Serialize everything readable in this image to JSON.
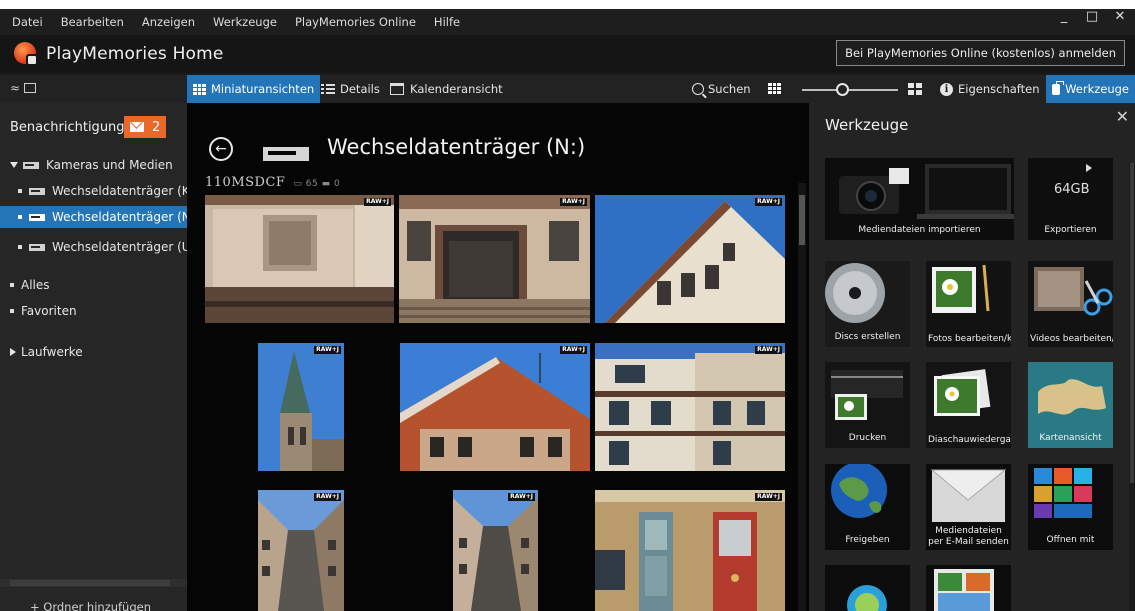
{
  "menu": [
    "Datei",
    "Bearbeiten",
    "Anzeigen",
    "Werkzeuge",
    "PlayMemories Online",
    "Hilfe"
  ],
  "window_controls": {
    "minimize": "_",
    "maximize": "□",
    "close": "✕"
  },
  "app": {
    "title": "PlayMemories Home",
    "signin_label": "Bei PlayMemories Online (kostenlos) anmelden"
  },
  "toolbar": {
    "thumbnails_label": "Miniaturansichten",
    "details_label": "Details",
    "calendar_label": "Kalenderansicht",
    "search_label": "Suchen",
    "properties_label": "Eigenschaften",
    "tools_label": "Werkzeuge",
    "zoom_level": 0.42
  },
  "sidebar": {
    "notifications_label": "Benachrichtigungen",
    "notifications_count": "2",
    "section_cameras": "Kameras und Medien",
    "drives": [
      "Wechseldatenträger (K",
      "Wechseldatenträger (N",
      "Wechseldatenträger (U"
    ],
    "selected_drive_index": 1,
    "all_label": "Alles",
    "favorites_label": "Favoriten",
    "drives_label": "Laufwerke",
    "add_folder_label": "+ Ordner hinzufügen"
  },
  "main": {
    "title": "Wechseldatenträger (N:)",
    "folder_label": "110MSDCF",
    "folder_meta": "▭ 65  ▬ 0",
    "raw_tag": "RAW+J"
  },
  "tools_panel": {
    "title": "Werkzeuge",
    "close": "✕",
    "tiles": [
      "Mediendateien importieren",
      "Exportieren",
      "Discs erstellen",
      "Fotos bearbeiten/kon...",
      "Videos bearbeiten/kon...",
      "Drucken",
      "Diaschauwiedergabe",
      "Kartenansicht",
      "Freigeben",
      "Mediendateien per E-Mail senden",
      "Öffnen mit"
    ],
    "export_capacity": "64GB"
  },
  "colors": {
    "accent": "#2474b8",
    "badge": "#e8692a"
  }
}
